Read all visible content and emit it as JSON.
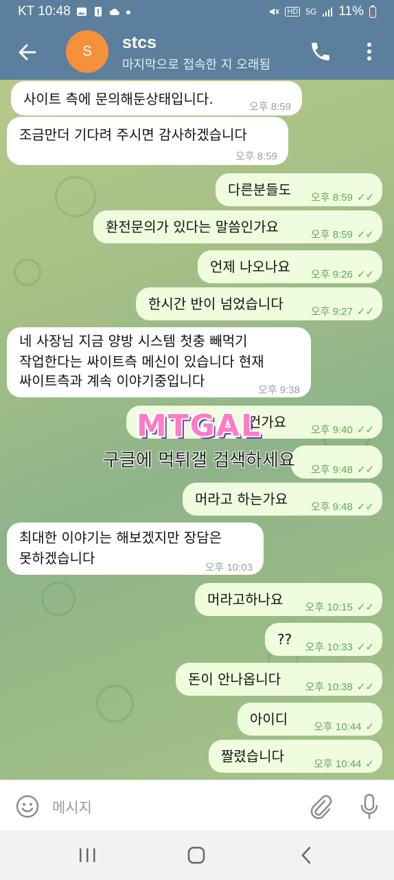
{
  "statusbar": {
    "carrier_time": "KT 10:48",
    "network": "5G",
    "battery": "11%"
  },
  "header": {
    "avatar_letter": "S",
    "title": "stcs",
    "subtitle": "마지막으로 접속한 지 오래됨"
  },
  "messages": [
    {
      "dir": "in",
      "lines": [
        "사이트 측에 문의해둔상태입니다."
      ],
      "time": "오후 8:59"
    },
    {
      "dir": "in",
      "lines": [
        "조금만더 기다려 주시면 감사하겠습니다"
      ],
      "time": "오후 8:59"
    },
    {
      "dir": "out",
      "lines": [
        "다른분들도"
      ],
      "time": "오후 8:59"
    },
    {
      "dir": "out",
      "lines": [
        "환전문의가 있다는 말씀인가요"
      ],
      "time": "오후 8:59"
    },
    {
      "dir": "out",
      "lines": [
        "언제 나오나요"
      ],
      "time": "오후 9:26"
    },
    {
      "dir": "out",
      "lines": [
        "한시간 반이 넘었습니다"
      ],
      "time": "오후 9:27"
    },
    {
      "dir": "in",
      "lines": [
        "네 사장님 지금 양방 시스템 첫충 빼먹기",
        "작업한다는 싸이트측 메신이 있습니다 현재",
        "싸이트측과 계속 이야기중입니다"
      ],
      "time": "오후 9:38"
    },
    {
      "dir": "out",
      "lines": [
        "건가요"
      ],
      "time": "오후 9:40"
    },
    {
      "dir": "out",
      "lines": [
        ""
      ],
      "time": "오후 9:48"
    },
    {
      "dir": "out",
      "lines": [
        "머라고 하는가요"
      ],
      "time": "오후 9:48"
    },
    {
      "dir": "in",
      "lines": [
        "최대한 이야기는 해보겠지만 장담은",
        "못하겠습니다"
      ],
      "time": "오후 10:03"
    },
    {
      "dir": "out",
      "lines": [
        "머라고하나요"
      ],
      "time": "오후 10:15"
    },
    {
      "dir": "out",
      "lines": [
        "??"
      ],
      "time": "오후 10:33"
    },
    {
      "dir": "out",
      "lines": [
        "돈이 안나옵니다"
      ],
      "time": "오후 10:38"
    },
    {
      "dir": "out",
      "lines": [
        "아이디"
      ],
      "time": "오후 10:44"
    },
    {
      "dir": "out",
      "lines": [
        "짤렸습니다"
      ],
      "time": "오후 10:44"
    }
  ],
  "watermark": {
    "logo": "MTGAL",
    "text": "구글에 먹튀갤 검색하세요"
  },
  "input": {
    "placeholder": "메시지"
  },
  "colors": {
    "header": "#5b7f9c",
    "avatar": "#f4913a",
    "outgoing": "#effdde",
    "incoming": "#ffffff",
    "check": "#5eab57"
  },
  "icons": {
    "back": "arrow-left-icon",
    "call": "phone-icon",
    "more": "more-vert-icon",
    "emoji": "smile-icon",
    "attach": "paperclip-icon",
    "mic": "mic-icon"
  }
}
